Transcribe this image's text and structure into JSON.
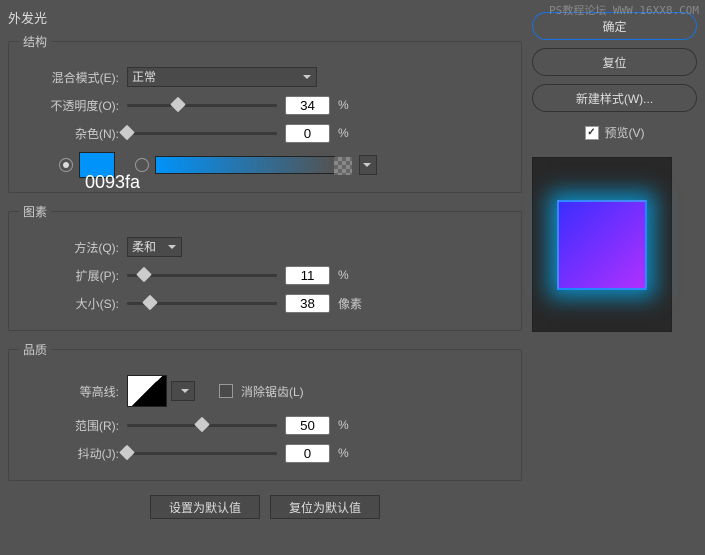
{
  "watermark": "PS教程论坛 WWW.16XX8.COM",
  "panel_title": "外发光",
  "structure": {
    "legend": "结构",
    "blend_label": "混合模式(E):",
    "blend_value": "正常",
    "opacity_label": "不透明度(O):",
    "opacity_value": "34",
    "opacity_unit": "%",
    "noise_label": "杂色(N):",
    "noise_value": "0",
    "noise_unit": "%",
    "color_hex": "#0093fa",
    "color_code": "0093fa"
  },
  "elements": {
    "legend": "图素",
    "technique_label": "方法(Q):",
    "technique_value": "柔和",
    "spread_label": "扩展(P):",
    "spread_value": "11",
    "spread_unit": "%",
    "size_label": "大小(S):",
    "size_value": "38",
    "size_unit": "像素"
  },
  "quality": {
    "legend": "品质",
    "contour_label": "等高线:",
    "antialias_label": "消除锯齿(L)",
    "range_label": "范围(R):",
    "range_value": "50",
    "range_unit": "%",
    "jitter_label": "抖动(J):",
    "jitter_value": "0",
    "jitter_unit": "%"
  },
  "buttons": {
    "set_default": "设置为默认值",
    "reset_default": "复位为默认值",
    "ok": "确定",
    "reset": "复位",
    "new_style": "新建样式(W)...",
    "preview": "预览(V)"
  }
}
